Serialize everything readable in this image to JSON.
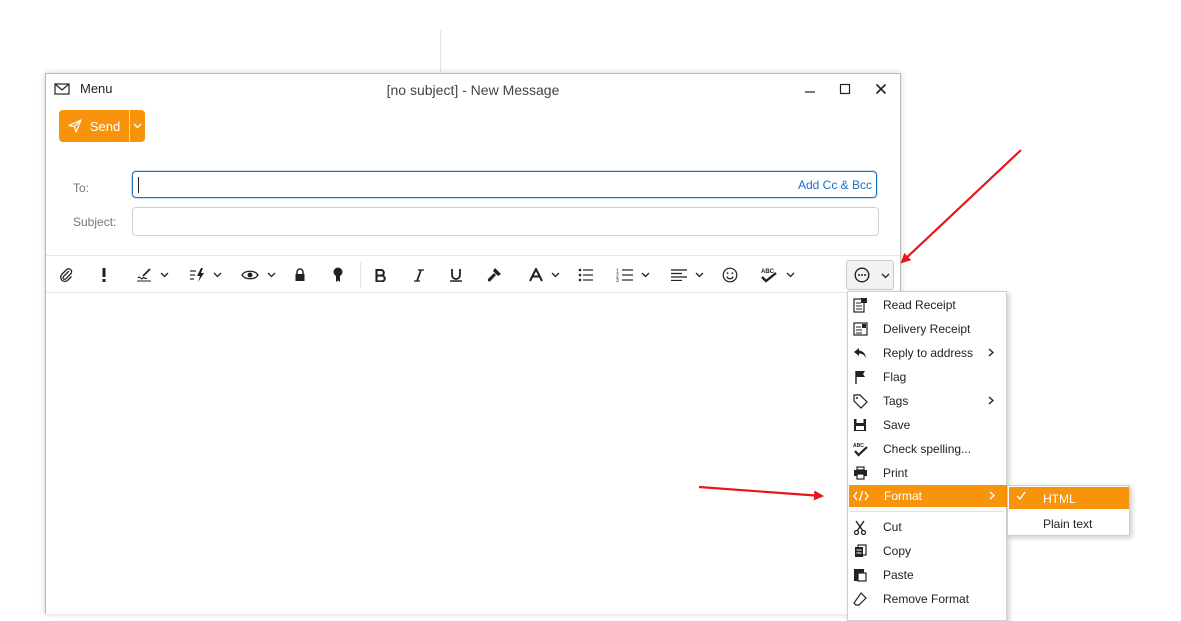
{
  "window": {
    "title": "[no subject] - New Message",
    "menu_label": "Menu",
    "minimize_icon": "minimize-icon",
    "maximize_icon": "maximize-icon",
    "close_icon": "close-icon"
  },
  "send": {
    "label": "Send",
    "icon": "paper-plane-icon",
    "color": "#f7940b"
  },
  "fields": {
    "to_label": "To:",
    "to_value": "",
    "add_cc_bcc": "Add Cc & Bcc",
    "subject_label": "Subject:",
    "subject_value": ""
  },
  "toolbar": {
    "icons": [
      "paperclip-icon",
      "priority-icon",
      "signature-icon",
      "quick-text-icon",
      "preview-icon",
      "lock-icon",
      "certificate-icon",
      "bold-icon",
      "italic-icon",
      "underline-icon",
      "format-painter-icon",
      "font-icon",
      "bullet-list-icon",
      "numbered-list-icon",
      "align-icon",
      "emoji-icon",
      "spell-check-icon",
      "more-icon"
    ]
  },
  "menu": {
    "items": [
      {
        "label": "Read Receipt",
        "icon": "read-receipt-icon"
      },
      {
        "label": "Delivery Receipt",
        "icon": "delivery-receipt-icon"
      },
      {
        "label": "Reply to address",
        "icon": "reply-icon",
        "has_submenu": true
      },
      {
        "label": "Flag",
        "icon": "flag-icon"
      },
      {
        "label": "Tags",
        "icon": "tag-icon",
        "has_submenu": true
      },
      {
        "label": "Save",
        "icon": "save-icon"
      },
      {
        "label": "Check spelling...",
        "icon": "spell-check-icon"
      },
      {
        "label": "Print",
        "icon": "print-icon"
      },
      {
        "label": "Format",
        "icon": "code-icon",
        "has_submenu": true,
        "active": true
      },
      {
        "label": "Cut",
        "icon": "scissors-icon"
      },
      {
        "label": "Copy",
        "icon": "copy-icon"
      },
      {
        "label": "Paste",
        "icon": "paste-icon"
      },
      {
        "label": "Remove Format",
        "icon": "eraser-icon"
      }
    ],
    "highlight_color": "#f7940b"
  },
  "format_submenu": {
    "items": [
      {
        "label": "HTML",
        "checked": true
      },
      {
        "label": "Plain text",
        "checked": false
      }
    ]
  },
  "annotation_color": "#e8161b"
}
